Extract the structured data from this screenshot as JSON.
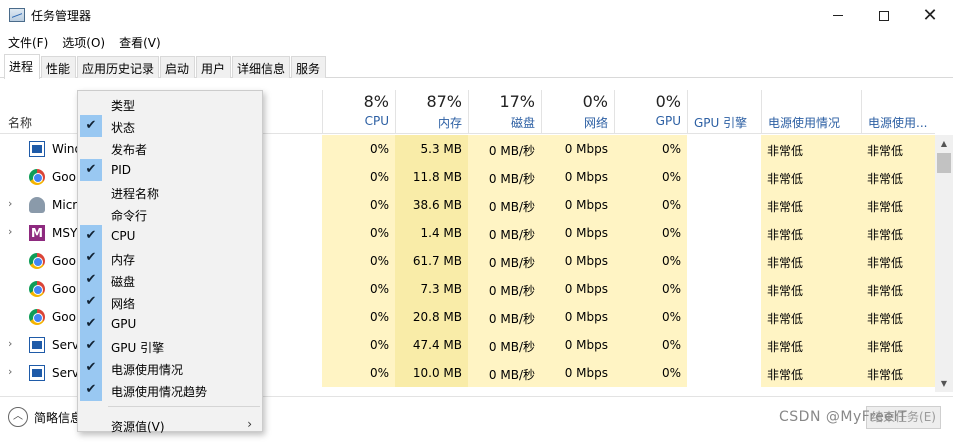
{
  "window": {
    "title": "任务管理器"
  },
  "menubar": [
    "文件(F)",
    "选项(O)",
    "查看(V)"
  ],
  "tabs": [
    "进程",
    "性能",
    "应用历史记录",
    "启动",
    "用户",
    "详细信息",
    "服务"
  ],
  "columns": {
    "name": "名称",
    "cpu": {
      "pct": "8%",
      "label": "CPU"
    },
    "memory": {
      "pct": "87%",
      "label": "内存"
    },
    "disk": {
      "pct": "17%",
      "label": "磁盘"
    },
    "network": {
      "pct": "0%",
      "label": "网络"
    },
    "gpu": {
      "pct": "0%",
      "label": "GPU"
    },
    "gpu_engine": "GPU 引擎",
    "power": "电源使用情况",
    "power_trend": "电源使用..."
  },
  "rows": [
    {
      "expand": false,
      "icon": "windows-app-icon",
      "name": "Wind",
      "cpu": "0%",
      "mem": "5.3 MB",
      "disk": "0 MB/秒",
      "net": "0 Mbps",
      "gpu": "0%",
      "gpu_engine": "",
      "power": "非常低",
      "power_trend": "非常低"
    },
    {
      "expand": false,
      "icon": "chrome-icon",
      "name": "Goo",
      "cpu": "0%",
      "mem": "11.8 MB",
      "disk": "0 MB/秒",
      "net": "0 Mbps",
      "gpu": "0%",
      "gpu_engine": "",
      "power": "非常低",
      "power_trend": "非常低"
    },
    {
      "expand": true,
      "icon": "user-icon",
      "name": "Micr",
      "cpu": "0%",
      "mem": "38.6 MB",
      "disk": "0 MB/秒",
      "net": "0 Mbps",
      "gpu": "0%",
      "gpu_engine": "",
      "power": "非常低",
      "power_trend": "非常低"
    },
    {
      "expand": true,
      "icon": "msys-icon",
      "name": "MSY",
      "cpu": "0%",
      "mem": "1.4 MB",
      "disk": "0 MB/秒",
      "net": "0 Mbps",
      "gpu": "0%",
      "gpu_engine": "",
      "power": "非常低",
      "power_trend": "非常低"
    },
    {
      "expand": false,
      "icon": "chrome-icon",
      "name": "Goo",
      "cpu": "0%",
      "mem": "61.7 MB",
      "disk": "0 MB/秒",
      "net": "0 Mbps",
      "gpu": "0%",
      "gpu_engine": "",
      "power": "非常低",
      "power_trend": "非常低"
    },
    {
      "expand": false,
      "icon": "chrome-icon",
      "name": "Goo",
      "cpu": "0%",
      "mem": "7.3 MB",
      "disk": "0 MB/秒",
      "net": "0 Mbps",
      "gpu": "0%",
      "gpu_engine": "",
      "power": "非常低",
      "power_trend": "非常低"
    },
    {
      "expand": false,
      "icon": "chrome-icon",
      "name": "Goo",
      "cpu": "0%",
      "mem": "20.8 MB",
      "disk": "0 MB/秒",
      "net": "0 Mbps",
      "gpu": "0%",
      "gpu_engine": "",
      "power": "非常低",
      "power_trend": "非常低"
    },
    {
      "expand": true,
      "icon": "windows-app-icon",
      "name": "Serv",
      "cpu": "0%",
      "mem": "47.4 MB",
      "disk": "0 MB/秒",
      "net": "0 Mbps",
      "gpu": "0%",
      "gpu_engine": "",
      "power": "非常低",
      "power_trend": "非常低"
    },
    {
      "expand": true,
      "icon": "windows-app-icon",
      "name": "Serv",
      "cpu": "0%",
      "mem": "10.0 MB",
      "disk": "0 MB/秒",
      "net": "0 Mbps",
      "gpu": "0%",
      "gpu_engine": "",
      "power": "非常低",
      "power_trend": "非常低"
    }
  ],
  "context_menu": {
    "items": [
      {
        "label": "类型",
        "checked": false
      },
      {
        "label": "状态",
        "checked": true
      },
      {
        "label": "发布者",
        "checked": false
      },
      {
        "label": "PID",
        "checked": true
      },
      {
        "label": "进程名称",
        "checked": false
      },
      {
        "label": "命令行",
        "checked": false
      },
      {
        "label": "CPU",
        "checked": true
      },
      {
        "label": "内存",
        "checked": true
      },
      {
        "label": "磁盘",
        "checked": true
      },
      {
        "label": "网络",
        "checked": true
      },
      {
        "label": "GPU",
        "checked": true
      },
      {
        "label": "GPU 引擎",
        "checked": true
      },
      {
        "label": "电源使用情况",
        "checked": true
      },
      {
        "label": "电源使用情况趋势",
        "checked": true
      }
    ],
    "submenu_label": "资源值(V)",
    "check_glyph": "✔",
    "arrow_glyph": "›"
  },
  "footer": {
    "fewer_details": "简略信息",
    "end_task": "结束任务(E)",
    "watermark": "CSDN @MyFreeIT"
  },
  "glyphs": {
    "expand": "›",
    "collapse": "︿",
    "scroll_up": "▲",
    "scroll_down": "▼",
    "close": "✕"
  },
  "colors": {
    "cpu_bg": "#fff4c4",
    "mem_bg": "#f9eca8",
    "check_bg": "#99c8f2",
    "accent": "#2c5fa3"
  }
}
